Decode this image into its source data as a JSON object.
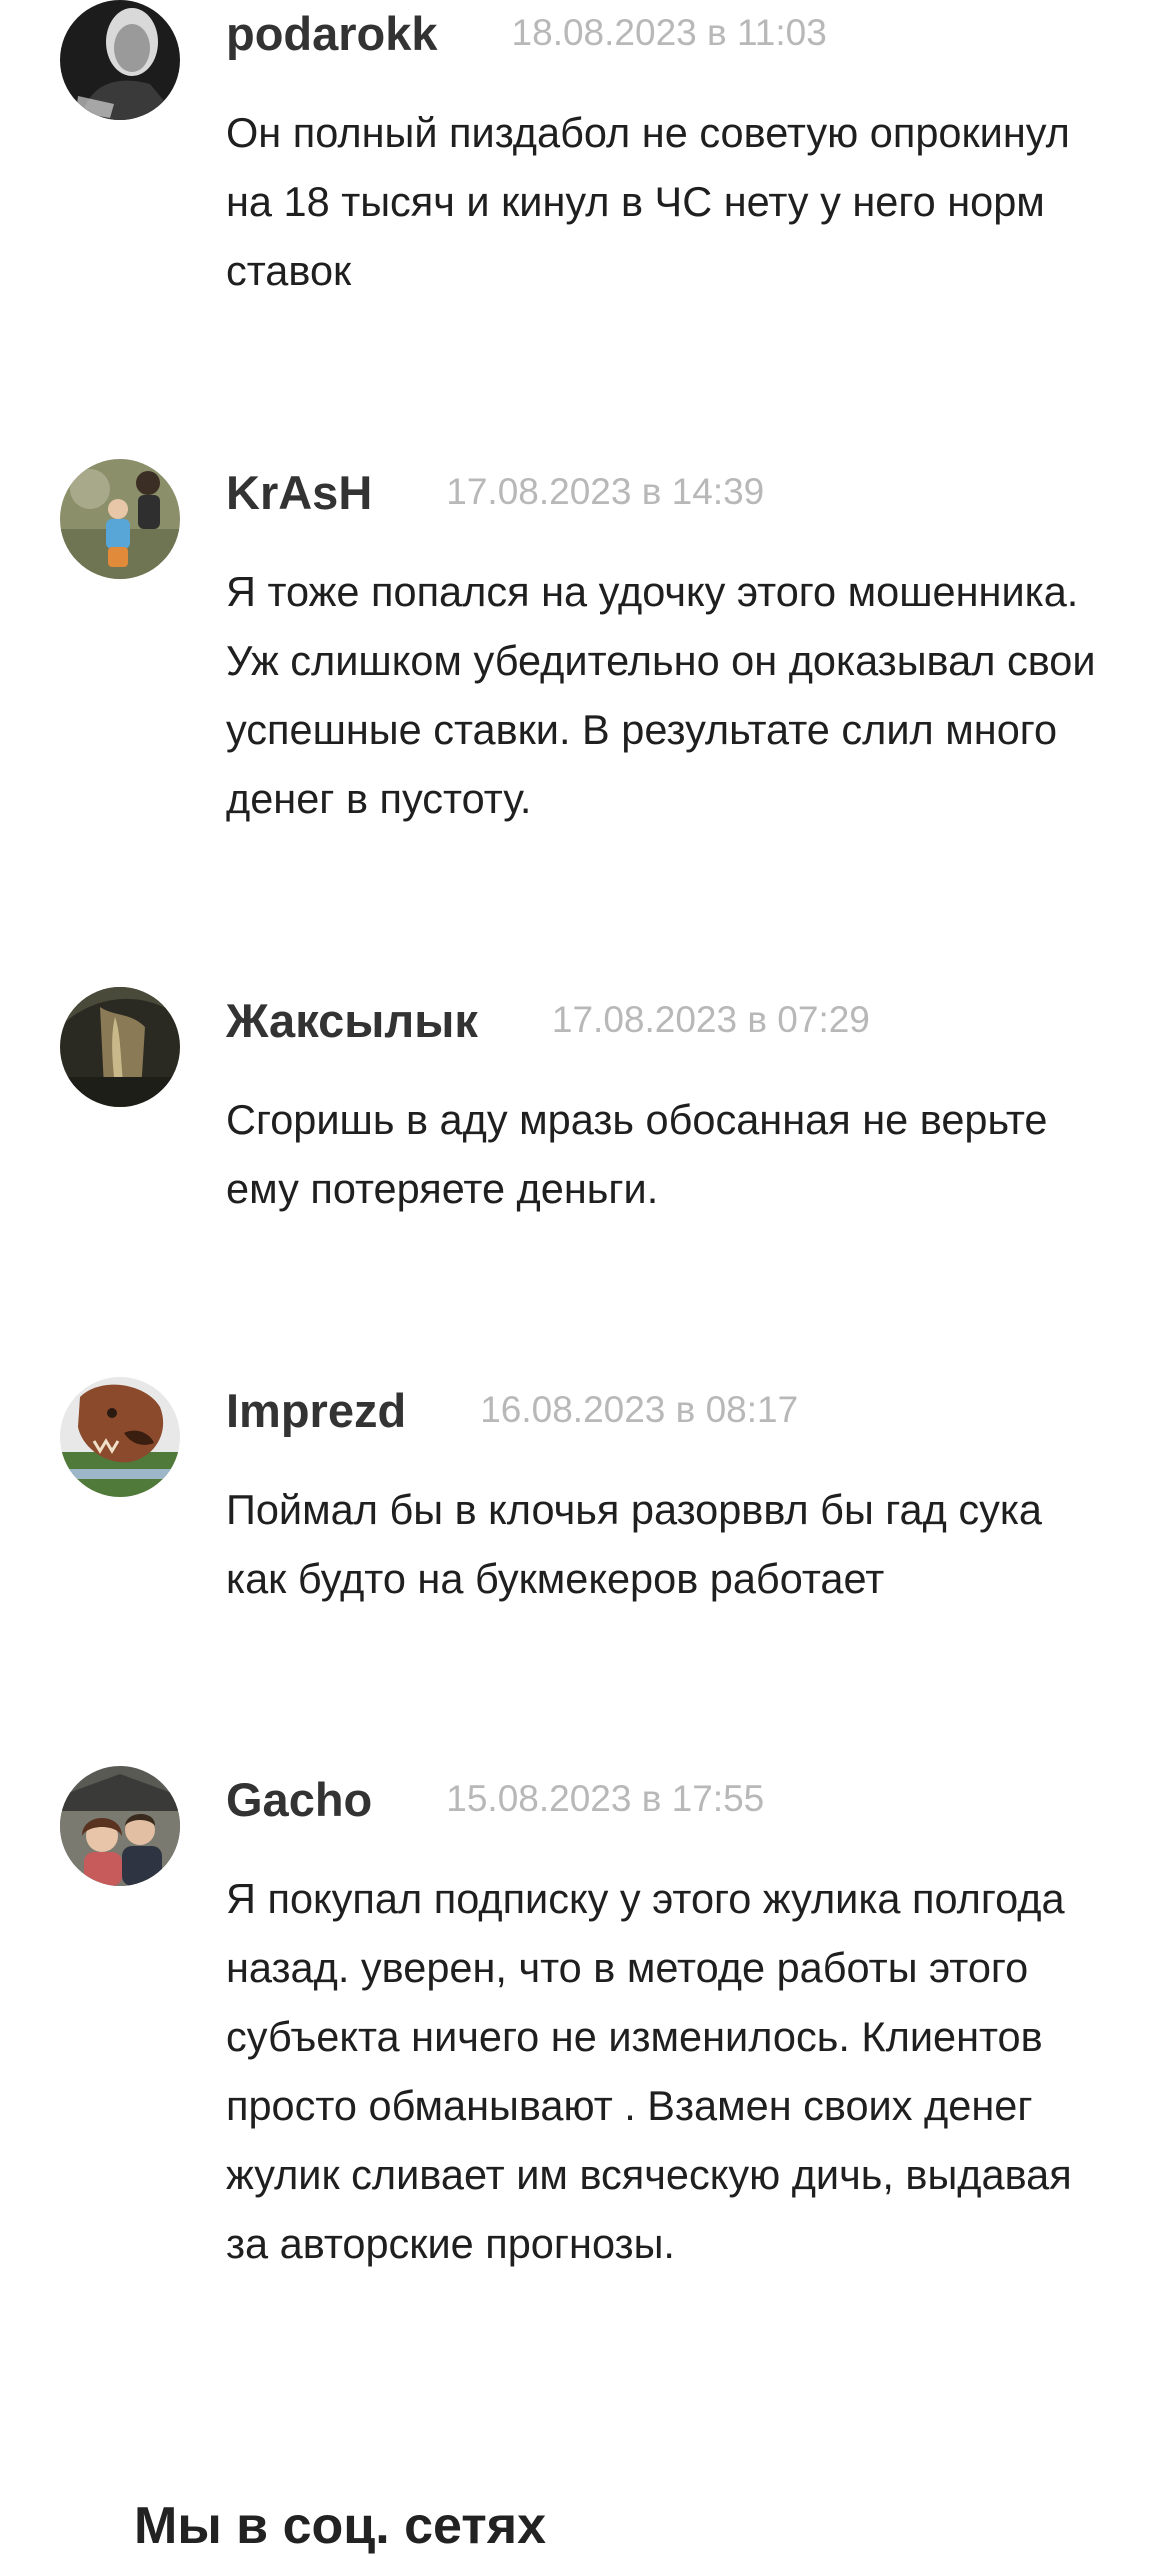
{
  "comments": [
    {
      "author": "podarokk",
      "date": "18.08.2023 в 11:03",
      "text": "Он полный пиздабол не советую опрокинул на 18 тысяч и кинул в ЧС нету у него норм ставок"
    },
    {
      "author": "KrAsH",
      "date": "17.08.2023 в 14:39",
      "text": "Я тоже попался на удочку этого мошенника. Уж слишком убедительно он доказывал свои успешные ставки. В результате слил много денег в пустоту."
    },
    {
      "author": "Жаксылык",
      "date": "17.08.2023 в 07:29",
      "text": "Сгоришь в аду мразь обосанная не верьте ему потеряете деньги."
    },
    {
      "author": "Imprezd",
      "date": "16.08.2023 в 08:17",
      "text": "Поймал бы в клочья разорввл бы гад сука как будто на букмекеров работает"
    },
    {
      "author": "Gacho",
      "date": "15.08.2023 в 17:55",
      "text": "Я покупал подписку у этого жулика полгода назад. уверен, что в методе работы этого субъекта ничего не изменилось. Клиентов просто обманывают . Взамен своих денег жулик сливает им всяческую дичь, выдавая за авторские прогнозы."
    }
  ],
  "footer": {
    "title": "Мы в соц. сетях"
  }
}
